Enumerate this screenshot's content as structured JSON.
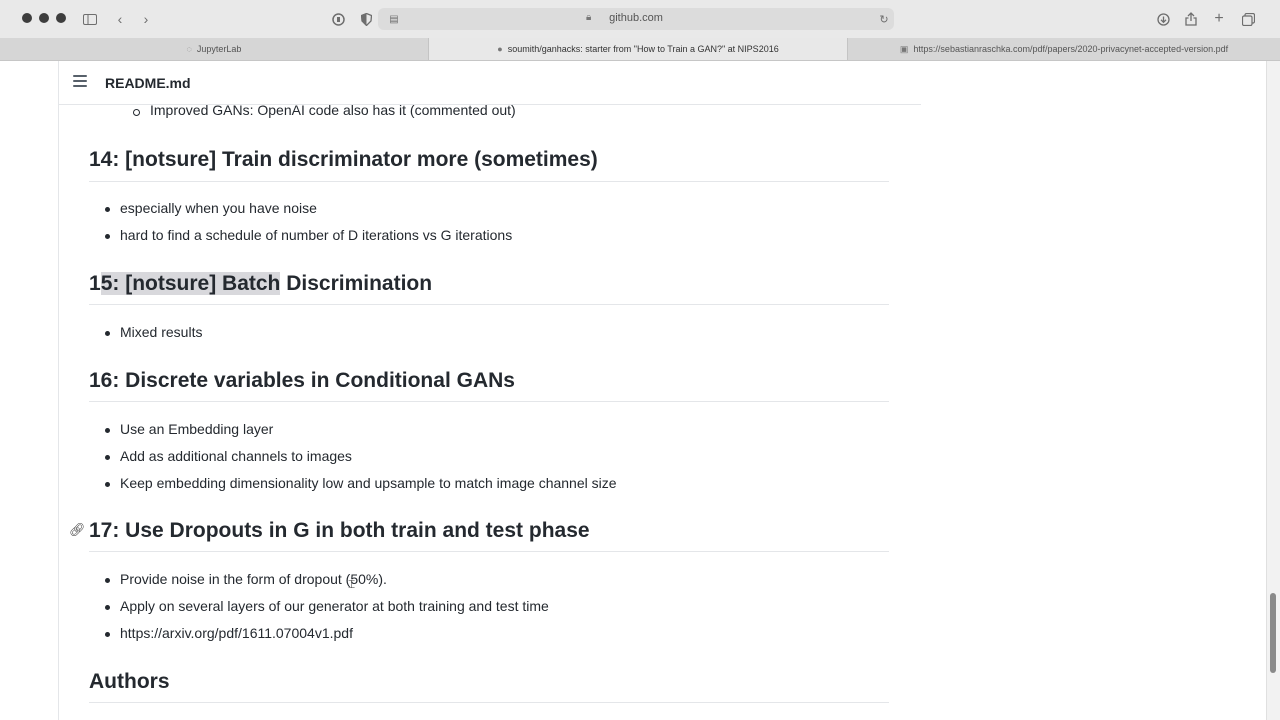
{
  "browser": {
    "url": "github.com",
    "tabs": [
      {
        "label": "JupyterLab",
        "icon": "spinner-icon"
      },
      {
        "label": "soumith/ganhacks: starter from \"How to Train a GAN?\" at NIPS2016",
        "icon": "github-icon"
      },
      {
        "label": "https://sebastianraschka.com/pdf/papers/2020-privacynet-accepted-version.pdf",
        "icon": "document-icon"
      }
    ]
  },
  "readme": {
    "title": "README.md",
    "top_item": "Improved GANs: OpenAI code also has it (commented out)",
    "sections": [
      {
        "heading": "14: [notsure] Train discriminator more (sometimes)",
        "items": [
          "especially when you have noise",
          "hard to find a schedule of number of D iterations vs G iterations"
        ]
      },
      {
        "heading_highlight": "5: [notsure] Batch",
        "heading_prefix": "1",
        "heading_suffix": " Discrimination",
        "items": [
          "Mixed results"
        ]
      },
      {
        "heading": "16: Discrete variables in Conditional GANs",
        "items": [
          "Use an Embedding layer",
          "Add as additional channels to images",
          "Keep embedding dimensionality low and upsample to match image channel size"
        ]
      },
      {
        "heading": "17: Use Dropouts in G in both train and test phase",
        "items": [
          "Provide noise in the form of dropout (50%).",
          "Apply on several layers of our generator at both training and test time",
          "https://arxiv.org/pdf/1611.07004v1.pdf"
        ]
      },
      {
        "heading": "Authors"
      }
    ]
  },
  "colors": {
    "text": "#24292f",
    "border": "#e4e6e9",
    "highlight": "#d8d8dc"
  }
}
